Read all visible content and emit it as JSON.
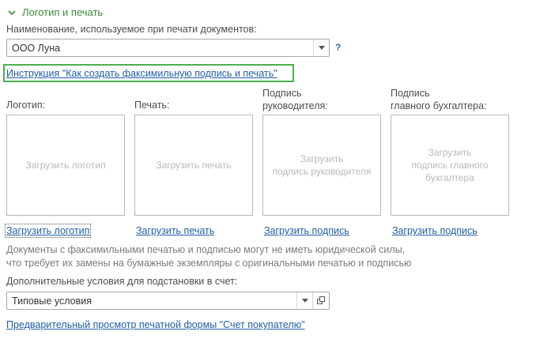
{
  "section": {
    "title": "Логотип и печать",
    "accent": "#3d8a3d"
  },
  "name_field": {
    "label": "Наименование, используемое при печати документов:",
    "value": "ООО Луна",
    "help": "?"
  },
  "instruction_link": "Инструкция \"Как создать факсимильную подпись и печать\"",
  "images": [
    {
      "label": "Логотип:",
      "placeholder": "Загрузить логотип",
      "link": "Загрузить логотип"
    },
    {
      "label": "Печать:",
      "placeholder": "Загрузить печать",
      "link": "Загрузить печать"
    },
    {
      "label": "Подпись\nруководителя:",
      "placeholder": "Загрузить\nподпись руководителя",
      "link": "Загрузить подпись"
    },
    {
      "label": "Подпись\nглавного бухгалтера:",
      "placeholder": "Загрузить\nподпись главного\nбухгалтера",
      "link": "Загрузить подпись"
    }
  ],
  "note": "Документы с факсимильными печатью и подписью могут не иметь юридической силы,\nчто требует их замены на бумажные экземпляры с оригинальными печатью и подписью",
  "conditions": {
    "label": "Дополнительные условия для подстановки в счет:",
    "value": "Типовые условия"
  },
  "preview_link": "Предварительный просмотр печатной формы \"Счет покупателю\"",
  "icons": {
    "expand": "chevron-down-icon",
    "dropdown": "triangle-down-icon",
    "open": "open-window-icon"
  },
  "colors": {
    "link": "#1f5fa8",
    "highlight": "#4caf50"
  }
}
